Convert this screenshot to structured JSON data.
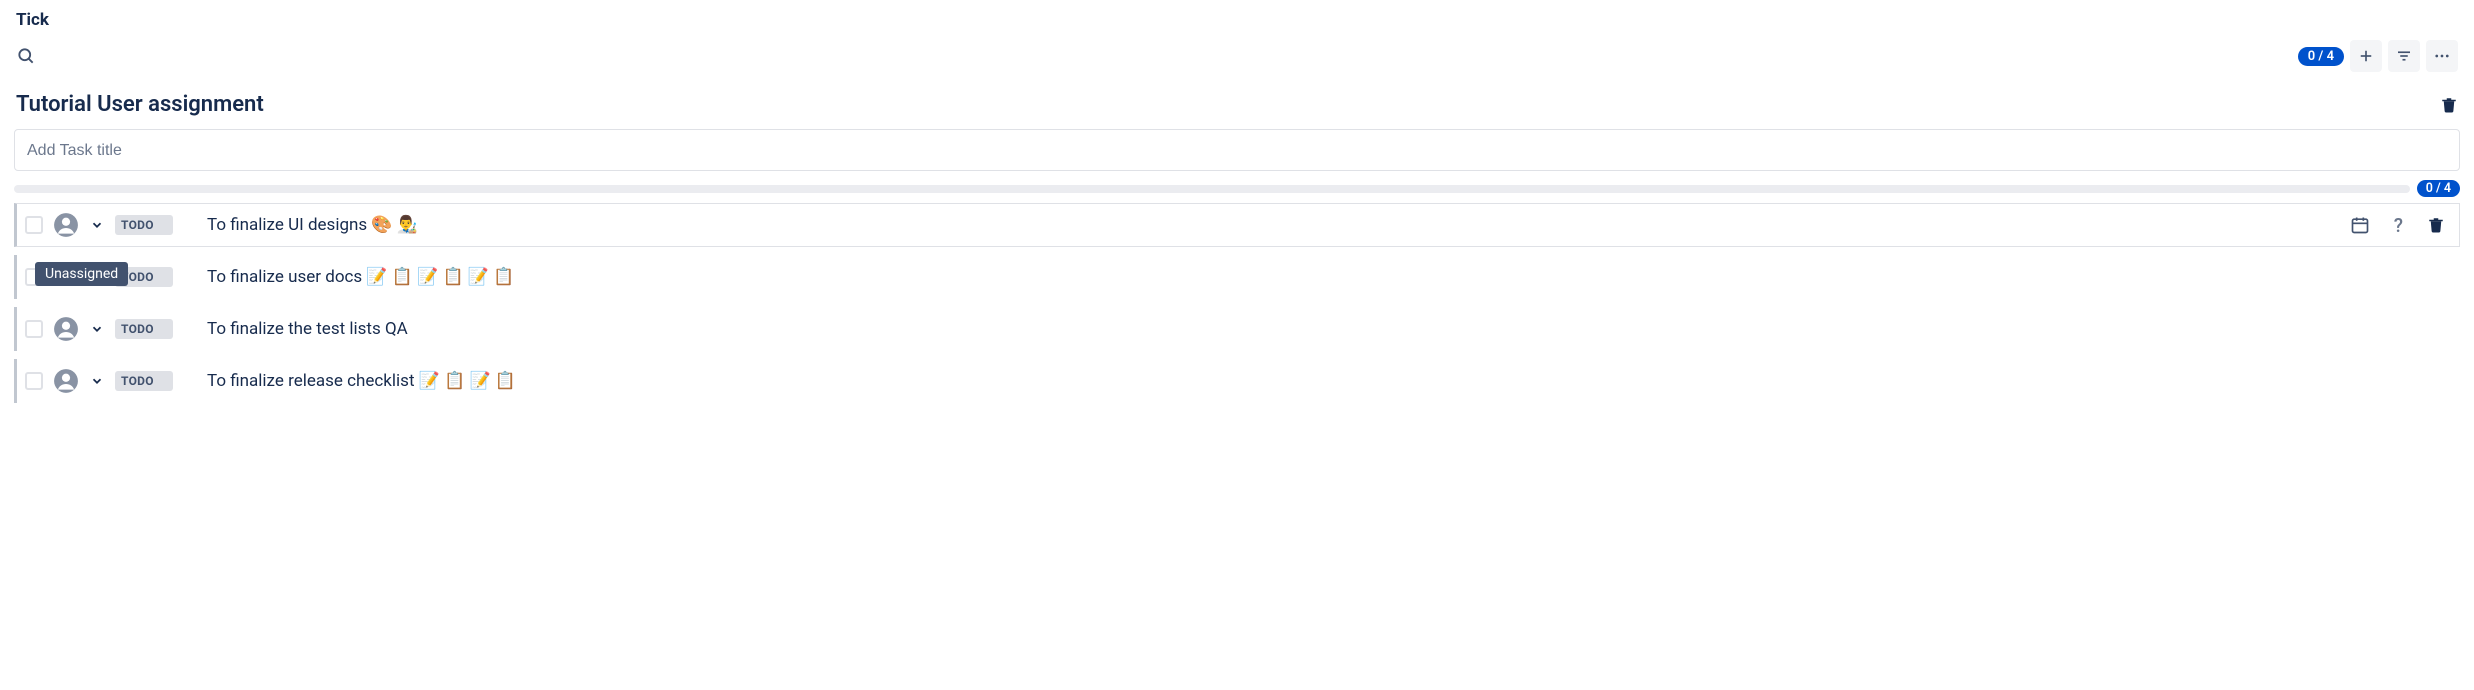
{
  "app_title": "Tick",
  "header": {
    "counter_badge": "0 / 4"
  },
  "section": {
    "title": "Tutorial User assignment",
    "add_task_placeholder": "Add Task title",
    "progress_badge": "0 / 4"
  },
  "tooltip": {
    "unassigned": "Unassigned"
  },
  "tasks": [
    {
      "status": "TODO",
      "title": "To finalize UI designs 🎨 👨‍🎨",
      "hovered": true
    },
    {
      "status": "TODO",
      "title": "To finalize user docs 📝 📋 📝 📋 📝 📋",
      "show_tooltip": true
    },
    {
      "status": "TODO",
      "title": "To finalize the test lists QA"
    },
    {
      "status": "TODO",
      "title": "To finalize release checklist 📝 📋 📝 📋"
    }
  ]
}
